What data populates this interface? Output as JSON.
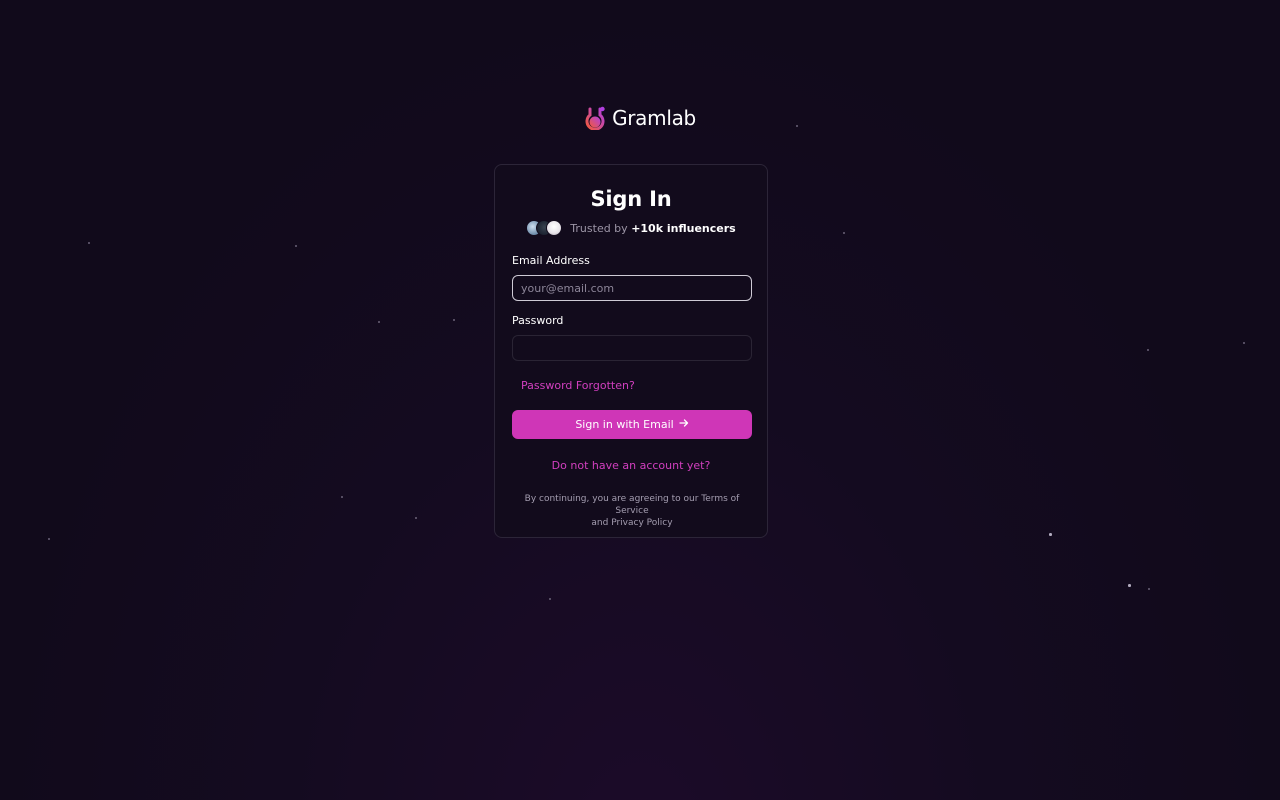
{
  "brand": {
    "name": "Gramlab",
    "logo_icon": "flask-icon",
    "colors": {
      "accent": "#d23fbf",
      "button": "#cf36b7",
      "logo_gradient": [
        "#f25a3c",
        "#b13fe0"
      ],
      "background": "#110a1b"
    }
  },
  "signin": {
    "title": "Sign In",
    "trusted_prefix": "Trusted by",
    "trusted_count": "+10k influencers",
    "email": {
      "label": "Email Address",
      "placeholder": "your@email.com",
      "value": ""
    },
    "password": {
      "label": "Password",
      "placeholder": "",
      "value": ""
    },
    "forgot_label": "Password Forgotten?",
    "submit_label": "Sign in with Email",
    "submit_icon": "arrow-right-icon",
    "signup_label": "Do not have an account yet?",
    "legal_line1": "By continuing, you are agreeing to our Terms of Service",
    "legal_line2": "and Privacy Policy"
  }
}
